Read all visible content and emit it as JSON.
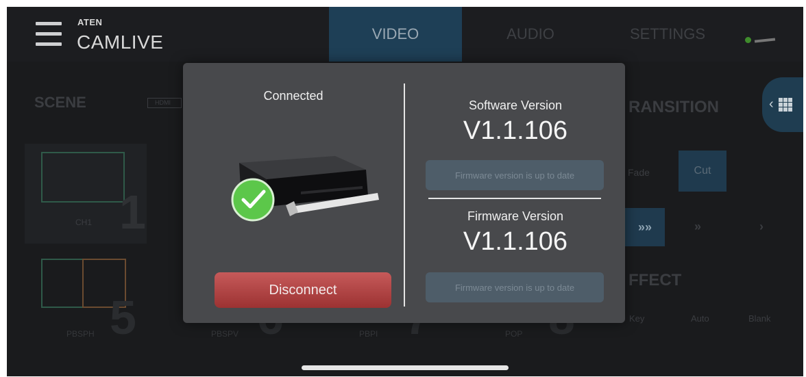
{
  "app": {
    "brand_small": "ATEN",
    "brand_main": "CAMLIVE"
  },
  "tabs": [
    {
      "label": "VIDEO",
      "active": true
    },
    {
      "label": "AUDIO",
      "active": false
    },
    {
      "label": "SETTINGS",
      "active": false
    }
  ],
  "background": {
    "scene_title": "SCENE",
    "hdmi_badge": "HDMI",
    "scenes": [
      {
        "label": "CH1",
        "number": "1"
      },
      {
        "label": "PBSPH",
        "number": "5"
      },
      {
        "label": "PBSPV",
        "number": "6"
      },
      {
        "label": "PBPI",
        "number": "7"
      },
      {
        "label": "POP",
        "number": "8"
      }
    ],
    "transition_title": "RANSITION",
    "fade_label": "Fade",
    "cut_label": "Cut",
    "speeds": [
      "»»",
      "»",
      "›"
    ],
    "effect_title": "FFECT",
    "effects": [
      "Key",
      "Auto",
      "Blank"
    ]
  },
  "modal": {
    "status": "Connected",
    "disconnect_label": "Disconnect",
    "software": {
      "label": "Software Version",
      "value": "V1.1.106",
      "status": "Firmware version is up to date"
    },
    "firmware": {
      "label": "Firmware Version",
      "value": "V1.1.106",
      "status": "Firmware version is up to date"
    }
  },
  "colors": {
    "accent_tab": "#1e3f56",
    "modal_bg": "#48494c",
    "disconnect": "#b54444",
    "check_green": "#5cc74a"
  },
  "icons": [
    "hamburger-menu-icon",
    "battery-icon",
    "grid-icon",
    "chevron-left-icon",
    "check-icon"
  ]
}
